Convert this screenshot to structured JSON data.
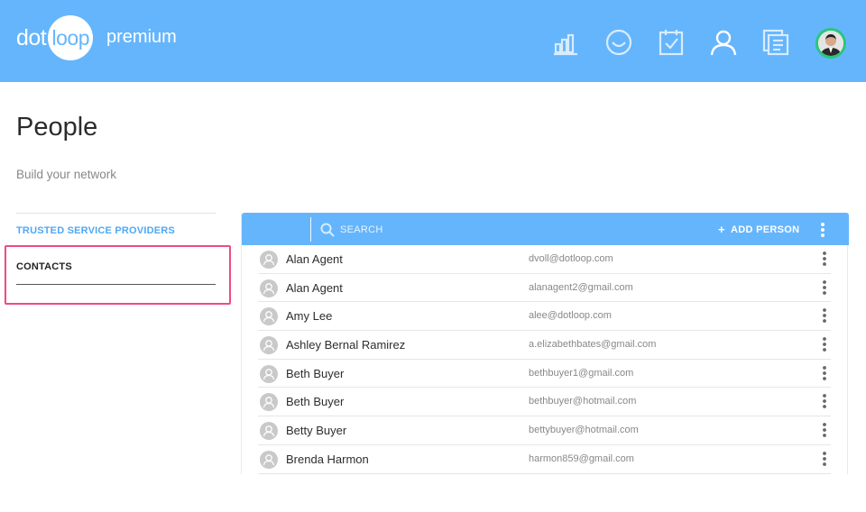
{
  "header": {
    "logo_dot": "dot",
    "logo_loop": "loop",
    "product": "premium",
    "nav_icons": [
      "bar-chart-icon",
      "smile-icon",
      "checklist-icon",
      "person-icon",
      "documents-icon"
    ],
    "brand_color": "#65b5fc"
  },
  "page": {
    "title": "People",
    "subtitle": "Build your network"
  },
  "sidebar": {
    "items": [
      {
        "label": "TRUSTED SERVICE PROVIDERS",
        "active": false
      },
      {
        "label": "CONTACTS",
        "active": true
      }
    ],
    "highlight_color": "#ef4b86"
  },
  "toolbar": {
    "search_placeholder": "SEARCH",
    "add_person_label": "ADD PERSON",
    "add_icon": "+"
  },
  "contacts": [
    {
      "name": "Alan Agent",
      "email": "dvoll@dotloop.com"
    },
    {
      "name": "Alan Agent",
      "email": "alanagent2@gmail.com"
    },
    {
      "name": "Amy Lee",
      "email": "alee@dotloop.com"
    },
    {
      "name": "Ashley Bernal Ramirez",
      "email": "a.elizabethbates@gmail.com"
    },
    {
      "name": "Beth Buyer",
      "email": "bethbuyer1@gmail.com"
    },
    {
      "name": "Beth Buyer",
      "email": "bethbuyer@hotmail.com"
    },
    {
      "name": "Betty Buyer",
      "email": "bettybuyer@hotmail.com"
    },
    {
      "name": "Brenda Harmon",
      "email": "harmon859@gmail.com"
    }
  ]
}
